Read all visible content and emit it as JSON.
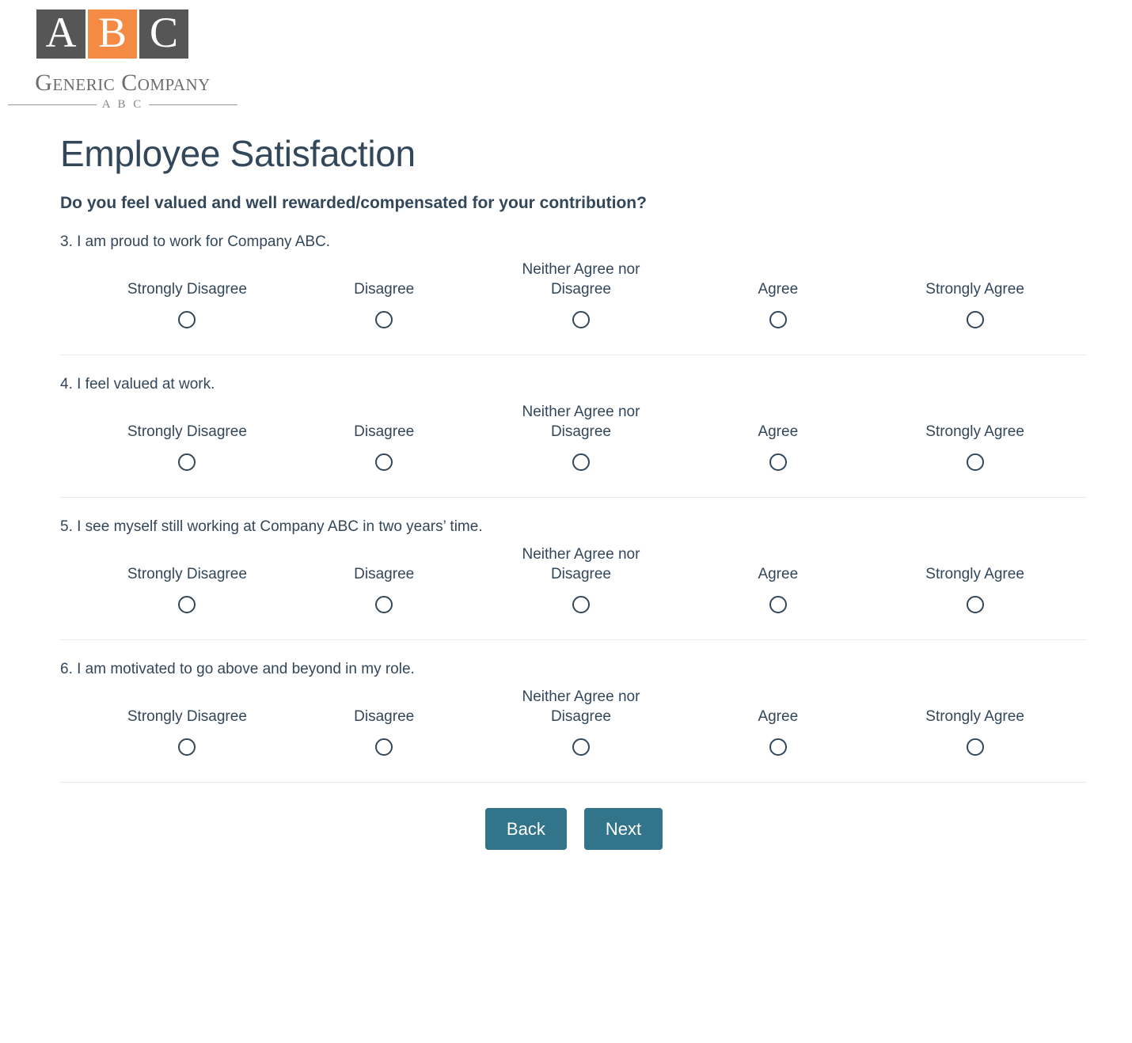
{
  "brand": {
    "logo_letters": [
      {
        "letter": "A",
        "color": "#565656"
      },
      {
        "letter": "B",
        "color": "#f58a44"
      },
      {
        "letter": "C",
        "color": "#565656"
      }
    ],
    "name": "Generic Company",
    "sub": "A B C"
  },
  "survey": {
    "title": "Employee Satisfaction",
    "section_question": "Do you feel valued and well rewarded/compensated for your contribution?",
    "scale_options": [
      "Strongly Disagree",
      "Disagree",
      "Neither Agree nor Disagree",
      "Agree",
      "Strongly Agree"
    ],
    "questions": [
      {
        "number": "3.",
        "text": "3. I am proud to work for Company ABC.",
        "selected": null
      },
      {
        "number": "4.",
        "text": "4. I feel valued at work.",
        "selected": null
      },
      {
        "number": "5.",
        "text": "5. I see myself still working at Company ABC in two years’ time.",
        "selected": null
      },
      {
        "number": "6.",
        "text": "6. I am motivated to go above and beyond in my role.",
        "selected": null
      }
    ]
  },
  "actions": {
    "back_label": "Back",
    "next_label": "Next"
  },
  "colors": {
    "text": "#33475b",
    "button": "#32748a",
    "divider": "#e8eaec",
    "logo_orange": "#f58a44",
    "logo_gray": "#565656"
  }
}
